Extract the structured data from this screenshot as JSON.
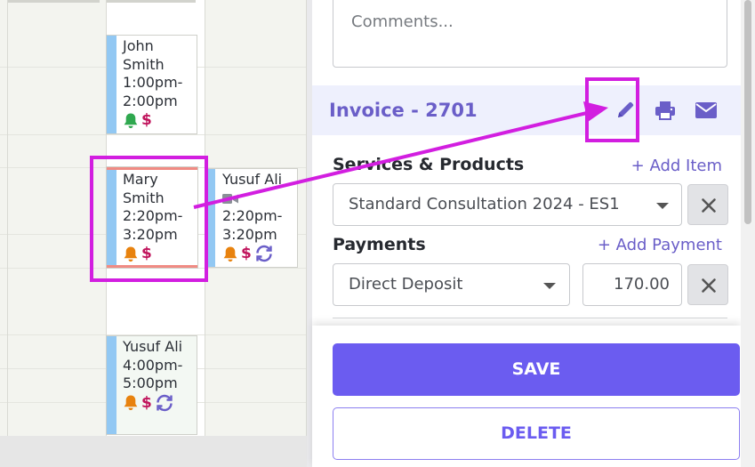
{
  "calendar": {
    "events": [
      {
        "lines": [
          "John",
          "Smith",
          "1:00pm-",
          "2:00pm"
        ],
        "icons": [
          "bell-green-icon",
          "dollar-icon"
        ],
        "colors": {
          "bell": "#2fa84f",
          "dollar": "#c0145c"
        }
      },
      {
        "lines": [
          "Mary",
          "Smith",
          "2:20pm-",
          "3:20pm"
        ],
        "icons": [
          "bell-orange-icon",
          "dollar-icon"
        ],
        "flag_color": "#f08b84",
        "colors": {
          "bell": "#e8820e",
          "dollar": "#c0145c"
        }
      },
      {
        "lines": [
          "Yusuf Ali",
          "",
          "2:20pm-",
          "3:20pm"
        ],
        "icons": [
          "video-icon",
          "bell-orange-icon",
          "dollar-icon",
          "recurring-icon"
        ],
        "colors": {
          "bell": "#e8820e",
          "dollar": "#c0145c",
          "recurring": "#6a5ec8"
        }
      },
      {
        "lines": [
          "Yusuf Ali",
          "4:00pm-",
          "5:00pm"
        ],
        "icons": [
          "bell-orange-icon",
          "dollar-icon",
          "recurring-icon"
        ],
        "colors": {
          "bell": "#e8820e",
          "dollar": "#c0145c",
          "recurring": "#6a5ec8"
        }
      }
    ],
    "dollar_symbol": "$"
  },
  "panel": {
    "comments": {
      "placeholder": "Comments..."
    },
    "invoice": {
      "title": "Invoice - 2701",
      "actions": [
        "edit-pencil-icon",
        "print-icon",
        "email-icon"
      ],
      "accent": "#6a5ec8",
      "bar_color": "#eef0fd"
    },
    "services": {
      "title": "Services & Products",
      "add_label": "+ Add Item",
      "selected": "Standard Consultation 2024 - ES1"
    },
    "payments": {
      "title": "Payments",
      "add_label": "+ Add Payment",
      "method": "Direct Deposit",
      "amount": "170.00"
    },
    "save_label": "SAVE",
    "delete_label": "DELETE",
    "save_color": "#6b5cf0"
  },
  "annotation": {
    "highlight_color": "#d21ee0",
    "targets": [
      "mary-smith-event",
      "edit-invoice-button"
    ]
  }
}
